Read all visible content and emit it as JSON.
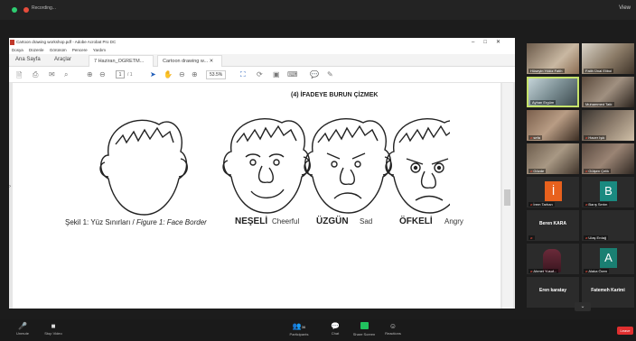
{
  "zoom": {
    "recording_label": "Recording...",
    "view_label": "View",
    "bottom": [
      {
        "name": "unmute",
        "glyph": "🎤",
        "label": "Unmute"
      },
      {
        "name": "stop-video",
        "glyph": "■",
        "label": "Stop Video"
      },
      {
        "name": "participants",
        "glyph": "👥",
        "count": "36",
        "label": "Participants"
      },
      {
        "name": "chat",
        "glyph": "💬",
        "label": "Chat"
      },
      {
        "name": "share-screen",
        "glyph": "",
        "label": "Share Screen"
      },
      {
        "name": "reactions",
        "glyph": "☺",
        "label": "Reactions"
      }
    ],
    "end_label": "Leave"
  },
  "acrobat": {
    "window_title": "Cartoon drawing workshop.pdf - Adobe Acrobat Pro DC",
    "menu": [
      "Dosya",
      "Düzenle",
      "Görünüm",
      "Pencere",
      "Yardım"
    ],
    "tabs": {
      "home": "Ana Sayfa",
      "tools": "Araçlar",
      "file1": "7 Haziran_OGRETM...",
      "file2": "Cartoon drawing w..."
    },
    "page_current": "1",
    "page_total": "/ 1",
    "zoom": "53.5%"
  },
  "document": {
    "heading": "(4) İFADEYE BURUN ÇİZMEK",
    "caption_tr": "Şekil 1: Yüz Sınırları / ",
    "caption_en": "Figure 1: Face Border",
    "emotions": [
      {
        "tr": "NEŞELİ",
        "en": "Cheerful"
      },
      {
        "tr": "ÜZGÜN",
        "en": "Sad"
      },
      {
        "tr": "ÖFKELİ",
        "en": "Angry"
      }
    ]
  },
  "gallery": {
    "tiles": [
      {
        "name": "Hüseyin Yıldız Fatih",
        "style": "cam1"
      },
      {
        "name": "Fatih Ünal Elibol",
        "style": "cam2"
      },
      {
        "name": "Ayhan Ergüm",
        "style": "cam3"
      },
      {
        "name": "Muhammed Tatlı",
        "style": "cam4"
      },
      {
        "name": "sefa",
        "style": "cam5"
      },
      {
        "name": "Hacer Işık",
        "style": "cam6"
      },
      {
        "name": "Gözde",
        "style": "cam7"
      },
      {
        "name": "Gülşen Çelik",
        "style": "cam8"
      },
      {
        "name": "İrem Tarhan",
        "letter": "İ",
        "color": "#e8611d"
      },
      {
        "name": "Barış Serim",
        "letter": "B",
        "color": "#1a8a80"
      },
      {
        "name": "Beren KARA",
        "big": true
      },
      {
        "name": "Ulaş Erdağ",
        "dark": true
      },
      {
        "name": "Ahmet Yusuf...",
        "person": true
      },
      {
        "name": "Alaka Özen",
        "letter": "A",
        "color": "#1a7f72"
      },
      {
        "name": "Eren karatay",
        "big": true
      },
      {
        "name": "Fatemeh Karimi",
        "big": true
      }
    ]
  }
}
